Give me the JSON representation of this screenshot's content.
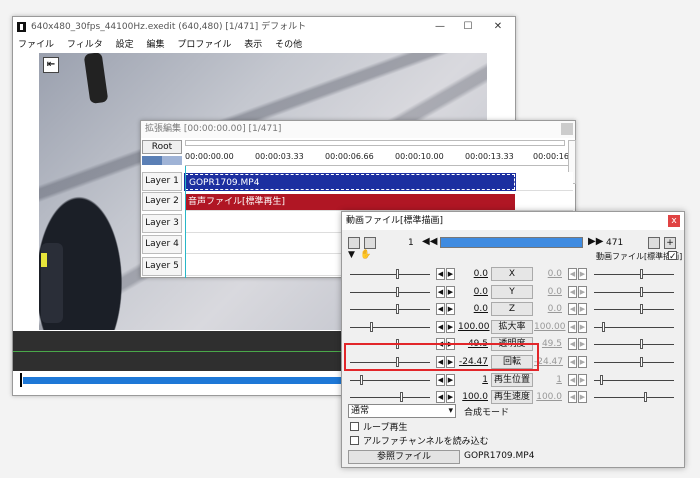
{
  "main_window": {
    "title": "640x480_30fps_44100Hz.exedit (640,480)  [1/471]  デフォルト",
    "minimize": "—",
    "maximize": "☐",
    "close": "✕",
    "menu": [
      "ファイル",
      "フィルタ",
      "設定",
      "編集",
      "プロファイル",
      "表示",
      "その他"
    ],
    "seek_icon": "⇤"
  },
  "timeline": {
    "title": "拡張編集 [00:00:00.00] [1/471]",
    "root_label": "Root",
    "ticks": [
      "00:00:00.00",
      "00:00:03.33",
      "00:00:06.66",
      "00:00:10.00",
      "00:00:13.33",
      "00:00:16"
    ],
    "layers": [
      "Layer 1",
      "Layer 2",
      "Layer 3",
      "Layer 4",
      "Layer 5"
    ],
    "clip_video": "GOPR1709.MP4",
    "clip_audio": "音声ファイル[標準再生]",
    "video_clip_color": "#1c2fa0",
    "audio_clip_color": "#b01624"
  },
  "properties": {
    "title": "動画ファイル[標準描画]",
    "close": "x",
    "frame_current": "1",
    "frame_total": "471",
    "mode_label": "動画ファイル[標準描画]",
    "params": [
      {
        "label": "X",
        "left": "0.0",
        "right": "0.0"
      },
      {
        "label": "Y",
        "left": "0.0",
        "right": "0.0"
      },
      {
        "label": "Z",
        "left": "0.0",
        "right": "0.0"
      },
      {
        "label": "拡大率",
        "left": "100.00",
        "right": "100.00"
      },
      {
        "label": "透明度",
        "left": "49.5",
        "right": "49.5"
      },
      {
        "label": "回転",
        "left": "-24.47",
        "right": "-24.47"
      },
      {
        "label": "再生位置",
        "left": "1",
        "right": "1"
      },
      {
        "label": "再生速度",
        "left": "100.0",
        "right": "100.0"
      }
    ],
    "blend_value": "通常",
    "blend_label": "合成モード",
    "loop_label": "ループ再生",
    "alpha_label": "アルファチャンネルを読み込む",
    "ref_button": "参照ファイル",
    "ref_file": "GOPR1709.MP4",
    "highlight_color": "#e2262a"
  }
}
